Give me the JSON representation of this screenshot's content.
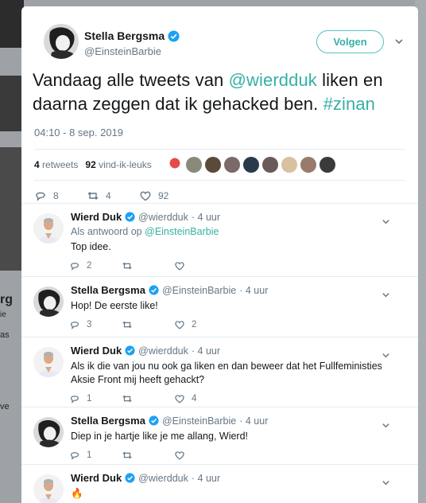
{
  "tweet": {
    "author_name": "Stella Bergsma",
    "author_handle": "@EinsteinBarbie",
    "follow_label": "Volgen",
    "text_part1": "Vandaag alle tweets van ",
    "mention": "@wierdduk",
    "text_part2": "  liken en daarna zeggen dat ik gehacked ben. ",
    "hashtag": "#zinan",
    "timestamp": "04:10 - 8 sep. 2019",
    "retweets_count": "4",
    "retweets_label": "retweets",
    "likes_count": "92",
    "likes_label": "vind-ik-leuks",
    "reply_count": "8",
    "retweet_count": "4",
    "like_count": "92"
  },
  "replies": [
    {
      "name": "Wierd Duk",
      "handle": "@wierdduk",
      "time": "· 4 uur",
      "reply_to_label": "Als antwoord op",
      "reply_to_handle": "@EinsteinBarbie",
      "text": "Top idee.",
      "replies": "2",
      "retweets": "",
      "likes": ""
    },
    {
      "name": "Stella Bergsma",
      "handle": "@EinsteinBarbie",
      "time": "· 4 uur",
      "text": "Hop! De eerste like!",
      "replies": "3",
      "retweets": "",
      "likes": "2"
    },
    {
      "name": "Wierd Duk",
      "handle": "@wierdduk",
      "time": "· 4 uur",
      "text": "Als ik die van jou nu ook ga liken en dan beweer dat het Fullfeministies Aksie Front mij heeft gehackt?",
      "replies": "1",
      "retweets": "",
      "likes": "4"
    },
    {
      "name": "Stella Bergsma",
      "handle": "@EinsteinBarbie",
      "time": "· 4 uur",
      "text": "Diep in je hartje like je me allang, Wierd!",
      "replies": "1",
      "retweets": "",
      "likes": ""
    },
    {
      "name": "Wierd Duk",
      "handle": "@wierdduk",
      "time": "· 4 uur",
      "text": "🔥"
    }
  ],
  "background": {
    "text1": "rg",
    "text2": "ie",
    "text3": "as",
    "text4": "ve"
  },
  "colors": {
    "accent": "#36b0a5",
    "verified": "#1da1f2",
    "muted": "#657786"
  }
}
